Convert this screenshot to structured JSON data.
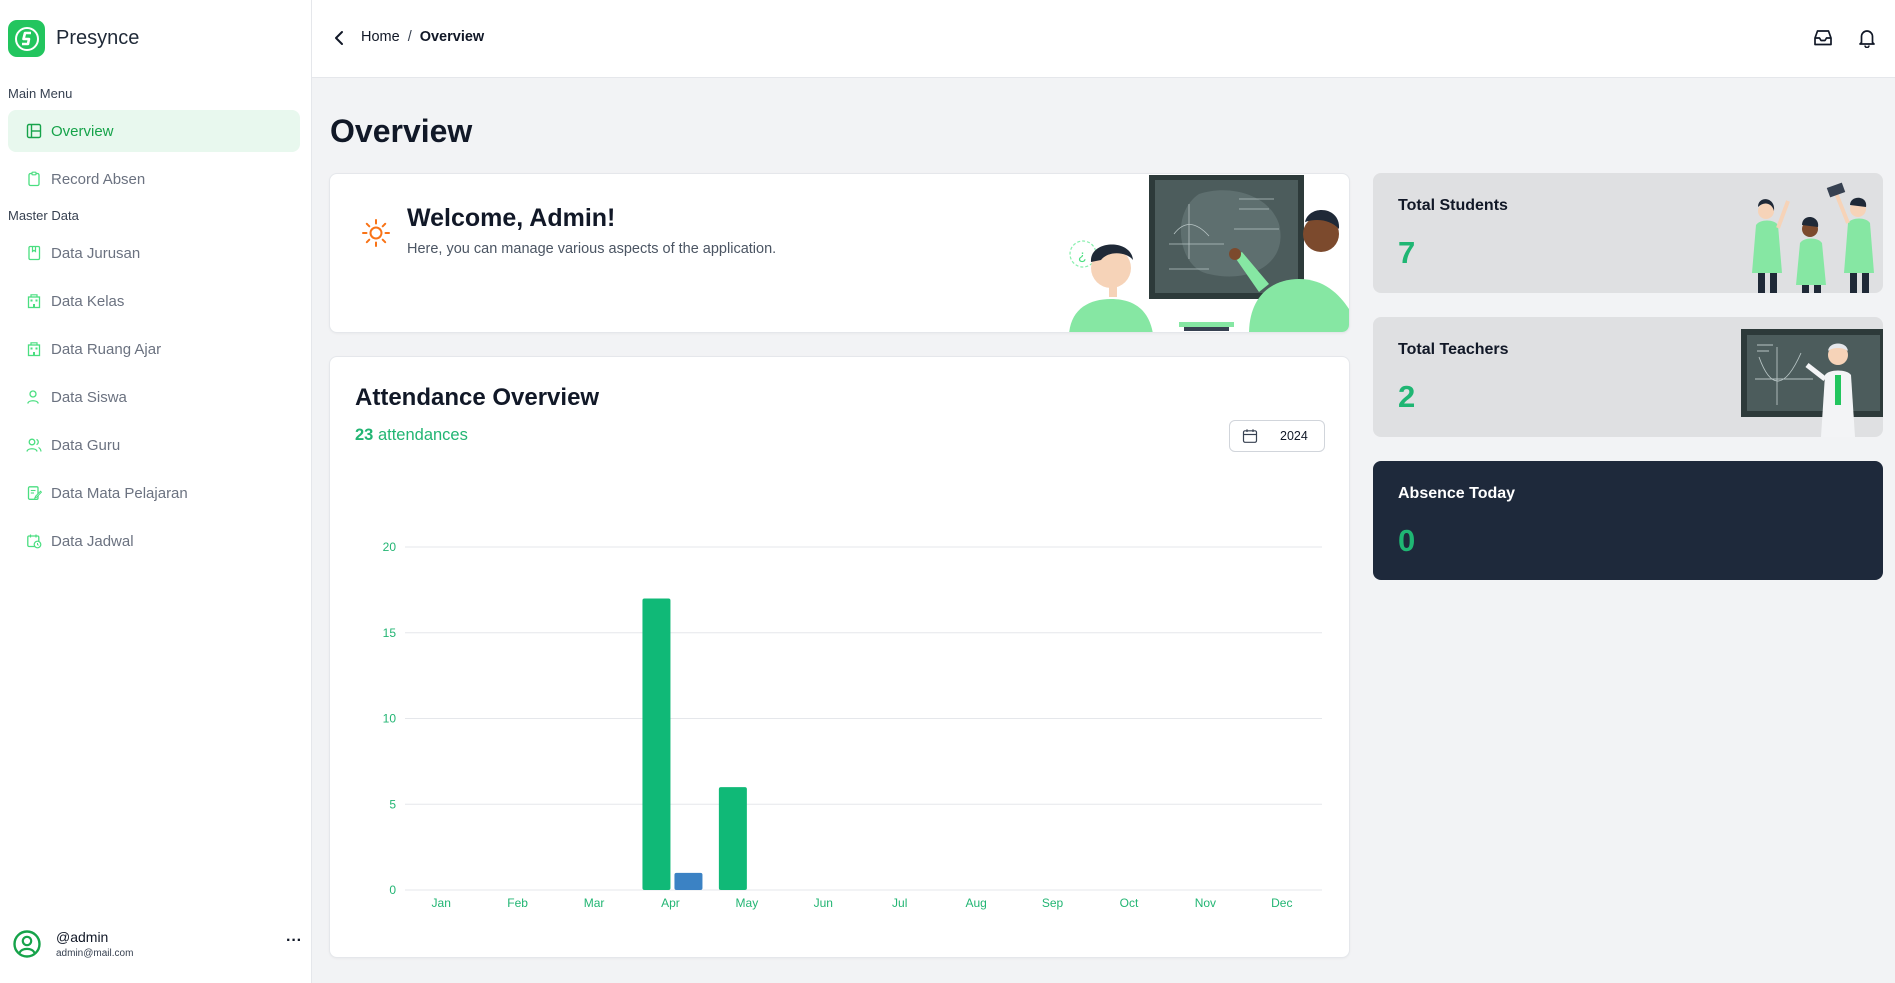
{
  "brand": {
    "name": "Presynce"
  },
  "sidebar": {
    "main_menu_label": "Main Menu",
    "master_data_label": "Master Data",
    "main_items": [
      {
        "label": "Overview",
        "icon": "layout-icon",
        "active": true
      },
      {
        "label": "Record Absen",
        "icon": "clipboard-icon",
        "active": false
      }
    ],
    "master_items": [
      {
        "label": "Data Jurusan",
        "icon": "book-icon"
      },
      {
        "label": "Data Kelas",
        "icon": "building-icon"
      },
      {
        "label": "Data Ruang Ajar",
        "icon": "building-icon"
      },
      {
        "label": "Data Siswa",
        "icon": "user-icon"
      },
      {
        "label": "Data Guru",
        "icon": "users-icon"
      },
      {
        "label": "Data Mata Pelajaran",
        "icon": "edit-note-icon"
      },
      {
        "label": "Data Jadwal",
        "icon": "calendar-clock-icon"
      }
    ]
  },
  "user": {
    "handle": "@admin",
    "email": "admin@mail.com",
    "more": "···"
  },
  "breadcrumb": {
    "home": "Home",
    "separator": "/",
    "current": "Overview"
  },
  "page": {
    "title": "Overview"
  },
  "welcome": {
    "title": "Welcome, Admin!",
    "subtitle": "Here, you can manage various aspects of the application."
  },
  "attendance": {
    "title": "Attendance Overview",
    "count": "23",
    "count_suffix": " attendances",
    "year": "2024"
  },
  "stats": [
    {
      "label": "Total Students",
      "value": "7"
    },
    {
      "label": "Total Teachers",
      "value": "2"
    },
    {
      "label": "Absence Today",
      "value": "0"
    }
  ],
  "colors": {
    "accent": "#22c55e",
    "bar_primary": "#10b977",
    "bar_secondary": "#3b82c4",
    "dark_card": "#1e293b"
  },
  "chart_data": {
    "type": "bar",
    "categories": [
      "Jan",
      "Feb",
      "Mar",
      "Apr",
      "May",
      "Jun",
      "Jul",
      "Aug",
      "Sep",
      "Oct",
      "Nov",
      "Dec"
    ],
    "series": [
      {
        "values": [
          0,
          0,
          0,
          17,
          6,
          0,
          0,
          0,
          0,
          0,
          0,
          0
        ]
      },
      {
        "values": [
          0,
          0,
          0,
          1,
          0,
          0,
          0,
          0,
          0,
          0,
          0,
          0
        ]
      }
    ],
    "yticks": [
      0,
      5,
      10,
      15,
      20
    ],
    "ylim": [
      0,
      20
    ],
    "grid": true,
    "title": "",
    "xlabel": "",
    "ylabel": ""
  }
}
